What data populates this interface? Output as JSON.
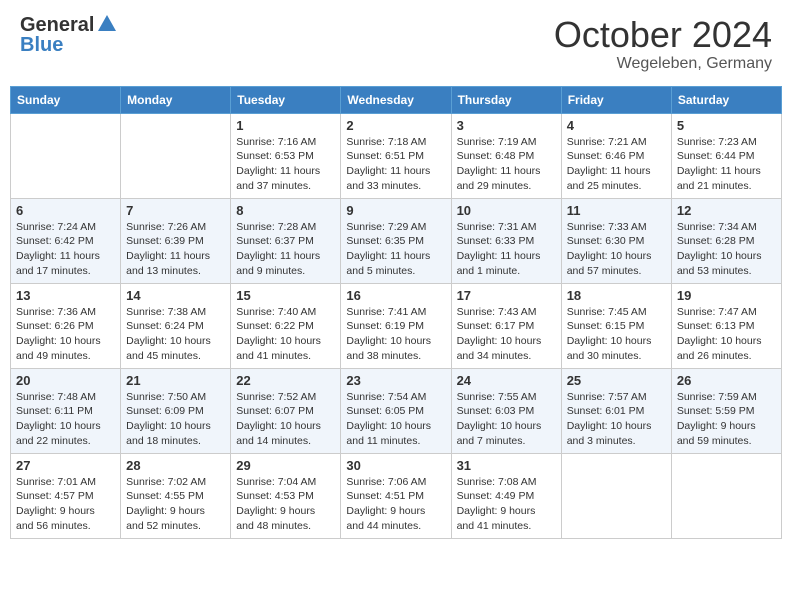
{
  "header": {
    "logo_general": "General",
    "logo_blue": "Blue",
    "month_title": "October 2024",
    "location": "Wegeleben, Germany"
  },
  "days_of_week": [
    "Sunday",
    "Monday",
    "Tuesday",
    "Wednesday",
    "Thursday",
    "Friday",
    "Saturday"
  ],
  "weeks": [
    [
      {
        "day": "",
        "info": ""
      },
      {
        "day": "",
        "info": ""
      },
      {
        "day": "1",
        "info": "Sunrise: 7:16 AM\nSunset: 6:53 PM\nDaylight: 11 hours and 37 minutes."
      },
      {
        "day": "2",
        "info": "Sunrise: 7:18 AM\nSunset: 6:51 PM\nDaylight: 11 hours and 33 minutes."
      },
      {
        "day": "3",
        "info": "Sunrise: 7:19 AM\nSunset: 6:48 PM\nDaylight: 11 hours and 29 minutes."
      },
      {
        "day": "4",
        "info": "Sunrise: 7:21 AM\nSunset: 6:46 PM\nDaylight: 11 hours and 25 minutes."
      },
      {
        "day": "5",
        "info": "Sunrise: 7:23 AM\nSunset: 6:44 PM\nDaylight: 11 hours and 21 minutes."
      }
    ],
    [
      {
        "day": "6",
        "info": "Sunrise: 7:24 AM\nSunset: 6:42 PM\nDaylight: 11 hours and 17 minutes."
      },
      {
        "day": "7",
        "info": "Sunrise: 7:26 AM\nSunset: 6:39 PM\nDaylight: 11 hours and 13 minutes."
      },
      {
        "day": "8",
        "info": "Sunrise: 7:28 AM\nSunset: 6:37 PM\nDaylight: 11 hours and 9 minutes."
      },
      {
        "day": "9",
        "info": "Sunrise: 7:29 AM\nSunset: 6:35 PM\nDaylight: 11 hours and 5 minutes."
      },
      {
        "day": "10",
        "info": "Sunrise: 7:31 AM\nSunset: 6:33 PM\nDaylight: 11 hours and 1 minute."
      },
      {
        "day": "11",
        "info": "Sunrise: 7:33 AM\nSunset: 6:30 PM\nDaylight: 10 hours and 57 minutes."
      },
      {
        "day": "12",
        "info": "Sunrise: 7:34 AM\nSunset: 6:28 PM\nDaylight: 10 hours and 53 minutes."
      }
    ],
    [
      {
        "day": "13",
        "info": "Sunrise: 7:36 AM\nSunset: 6:26 PM\nDaylight: 10 hours and 49 minutes."
      },
      {
        "day": "14",
        "info": "Sunrise: 7:38 AM\nSunset: 6:24 PM\nDaylight: 10 hours and 45 minutes."
      },
      {
        "day": "15",
        "info": "Sunrise: 7:40 AM\nSunset: 6:22 PM\nDaylight: 10 hours and 41 minutes."
      },
      {
        "day": "16",
        "info": "Sunrise: 7:41 AM\nSunset: 6:19 PM\nDaylight: 10 hours and 38 minutes."
      },
      {
        "day": "17",
        "info": "Sunrise: 7:43 AM\nSunset: 6:17 PM\nDaylight: 10 hours and 34 minutes."
      },
      {
        "day": "18",
        "info": "Sunrise: 7:45 AM\nSunset: 6:15 PM\nDaylight: 10 hours and 30 minutes."
      },
      {
        "day": "19",
        "info": "Sunrise: 7:47 AM\nSunset: 6:13 PM\nDaylight: 10 hours and 26 minutes."
      }
    ],
    [
      {
        "day": "20",
        "info": "Sunrise: 7:48 AM\nSunset: 6:11 PM\nDaylight: 10 hours and 22 minutes."
      },
      {
        "day": "21",
        "info": "Sunrise: 7:50 AM\nSunset: 6:09 PM\nDaylight: 10 hours and 18 minutes."
      },
      {
        "day": "22",
        "info": "Sunrise: 7:52 AM\nSunset: 6:07 PM\nDaylight: 10 hours and 14 minutes."
      },
      {
        "day": "23",
        "info": "Sunrise: 7:54 AM\nSunset: 6:05 PM\nDaylight: 10 hours and 11 minutes."
      },
      {
        "day": "24",
        "info": "Sunrise: 7:55 AM\nSunset: 6:03 PM\nDaylight: 10 hours and 7 minutes."
      },
      {
        "day": "25",
        "info": "Sunrise: 7:57 AM\nSunset: 6:01 PM\nDaylight: 10 hours and 3 minutes."
      },
      {
        "day": "26",
        "info": "Sunrise: 7:59 AM\nSunset: 5:59 PM\nDaylight: 9 hours and 59 minutes."
      }
    ],
    [
      {
        "day": "27",
        "info": "Sunrise: 7:01 AM\nSunset: 4:57 PM\nDaylight: 9 hours and 56 minutes."
      },
      {
        "day": "28",
        "info": "Sunrise: 7:02 AM\nSunset: 4:55 PM\nDaylight: 9 hours and 52 minutes."
      },
      {
        "day": "29",
        "info": "Sunrise: 7:04 AM\nSunset: 4:53 PM\nDaylight: 9 hours and 48 minutes."
      },
      {
        "day": "30",
        "info": "Sunrise: 7:06 AM\nSunset: 4:51 PM\nDaylight: 9 hours and 44 minutes."
      },
      {
        "day": "31",
        "info": "Sunrise: 7:08 AM\nSunset: 4:49 PM\nDaylight: 9 hours and 41 minutes."
      },
      {
        "day": "",
        "info": ""
      },
      {
        "day": "",
        "info": ""
      }
    ]
  ]
}
